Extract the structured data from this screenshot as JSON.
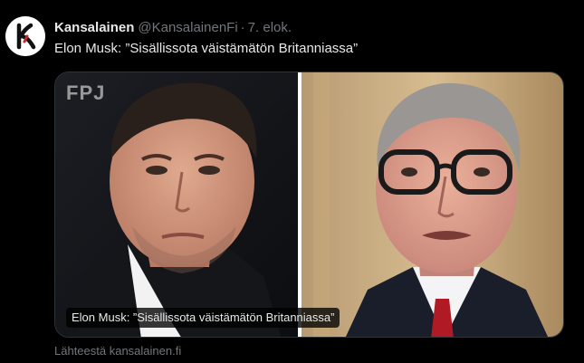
{
  "author": {
    "display_name": "Kansalainen",
    "handle": "@KansalainenFi",
    "separator": "·",
    "date": "7. elok.",
    "avatar_icon": "kansalainen-k-logo-icon"
  },
  "tweet": {
    "text": "Elon Musk: ”Sisällissota väistämätön Britanniassa”"
  },
  "card": {
    "watermark": "FPJ",
    "caption": "Elon Musk: ”Sisällissota väistämätön Britanniassa”",
    "source": "Lähteestä kansalainen.fi"
  },
  "colors": {
    "background": "#000000",
    "primary_text": "#e7e9ea",
    "secondary_text": "#71767b",
    "border": "#2f3336"
  }
}
